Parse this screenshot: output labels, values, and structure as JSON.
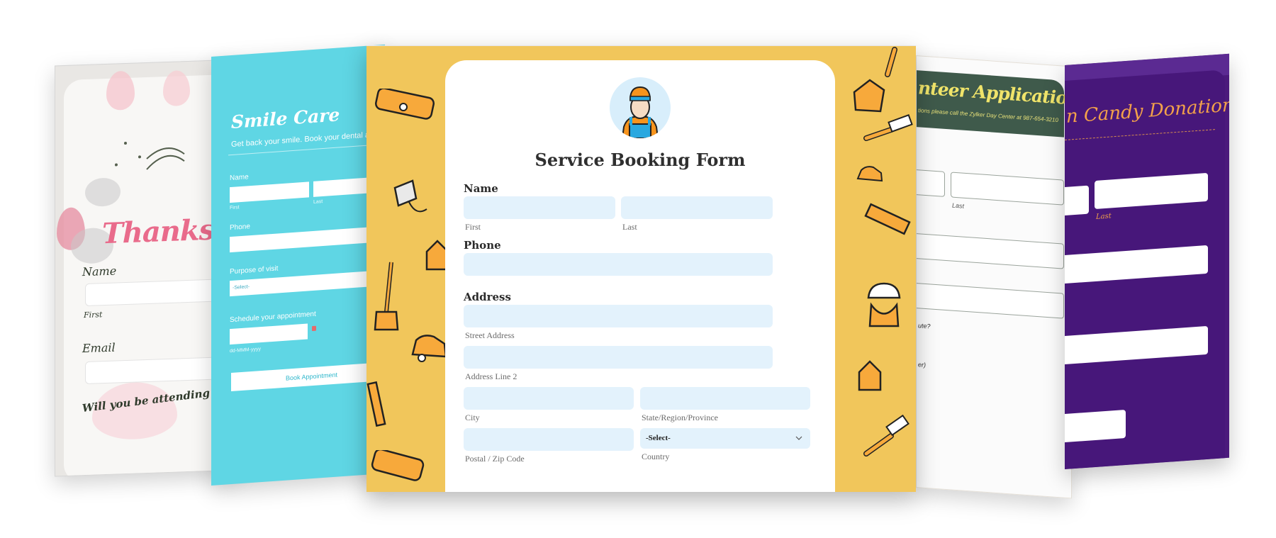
{
  "thanksgiving_form": {
    "title": "Thanksgiv",
    "name_label": "Name",
    "first_label": "First",
    "email_label": "Email",
    "question": "Will you be attending the ev"
  },
  "smile_care_form": {
    "title": "Smile Care",
    "subtitle": "Get back your smile. Book your dental appointment today!",
    "name_label": "Name",
    "first_label": "First",
    "last_label": "Last",
    "phone_label": "Phone",
    "purpose_label": "Purpose of visit",
    "purpose_value": "-Select-",
    "schedule_label": "Schedule your appointment",
    "date_format": "dd-MMM-yyyy",
    "submit_label": "Book Appointment"
  },
  "service_form": {
    "title": "Service Booking Form",
    "name_label": "Name",
    "first_label": "First",
    "last_label": "Last",
    "phone_label": "Phone",
    "address_label": "Address",
    "street_label": "Street Address",
    "line2_label": "Address Line 2",
    "city_label": "City",
    "state_label": "State/Region/Province",
    "zip_label": "Postal / Zip Code",
    "country_label": "Country",
    "country_value": "-Select-",
    "colors": {
      "accent_bg": "#f1c65b",
      "field_bg": "#e3f2fc",
      "avatar_bg": "#d8eefb"
    }
  },
  "volunteer_form": {
    "title": "nteer Application",
    "subtitle": "tions please call the Zylker Day Center at 987-654-3210",
    "last_label": "Last",
    "question_fragment": "ute?",
    "other_fragment": "er)"
  },
  "candy_form": {
    "title": "n Candy Donation",
    "last_label": "Last"
  }
}
